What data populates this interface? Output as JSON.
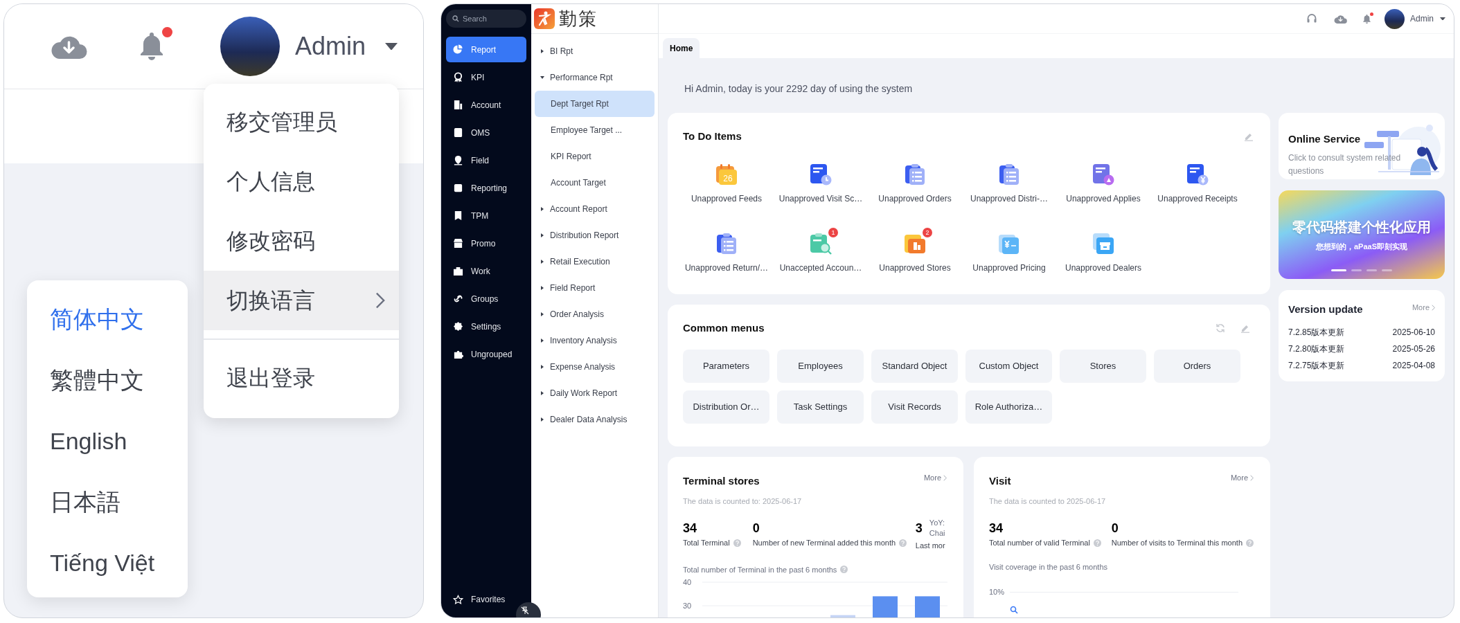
{
  "profile_preview": {
    "user_name": "Admin",
    "notification_dot": true,
    "user_menu": [
      {
        "label": "移交管理员",
        "highlighted": false,
        "has_submenu": false,
        "divider_before": false
      },
      {
        "label": "个人信息",
        "highlighted": false,
        "has_submenu": false,
        "divider_before": false
      },
      {
        "label": "修改密码",
        "highlighted": false,
        "has_submenu": false,
        "divider_before": false
      },
      {
        "label": "切换语言",
        "highlighted": true,
        "has_submenu": true,
        "divider_before": false
      },
      {
        "label": "退出登录",
        "highlighted": false,
        "has_submenu": false,
        "divider_before": true
      }
    ],
    "language_menu": [
      {
        "label": "简体中文",
        "selected": true
      },
      {
        "label": "繁體中文",
        "selected": false
      },
      {
        "label": "English",
        "selected": false
      },
      {
        "label": "日本語",
        "selected": false
      },
      {
        "label": "Tiếng Việt",
        "selected": false
      }
    ]
  },
  "app": {
    "search": {
      "placeholder": "Search"
    },
    "nav": [
      {
        "label": "Report",
        "selected": true
      },
      {
        "label": "KPI",
        "selected": false
      },
      {
        "label": "Account",
        "selected": false
      },
      {
        "label": "OMS",
        "selected": false
      },
      {
        "label": "Field",
        "selected": false
      },
      {
        "label": "Reporting",
        "selected": false
      },
      {
        "label": "TPM",
        "selected": false
      },
      {
        "label": "Promo",
        "selected": false
      },
      {
        "label": "Work",
        "selected": false
      },
      {
        "label": "Groups",
        "selected": false
      },
      {
        "label": "Settings",
        "selected": false
      },
      {
        "label": "Ungrouped",
        "selected": false
      }
    ],
    "favorites": "Favorites",
    "logo_text": "勤策",
    "submenu": [
      {
        "label": "BI Rpt",
        "expanded": false,
        "selected": false
      },
      {
        "label": "Performance Rpt",
        "expanded": true,
        "selected": false,
        "children": [
          {
            "label": "Dept Target Rpt",
            "selected": true
          },
          {
            "label": "Employee Target ...",
            "selected": false
          },
          {
            "label": "KPI Report",
            "selected": false
          },
          {
            "label": "Account Target",
            "selected": false
          }
        ]
      },
      {
        "label": "Account Report",
        "expanded": false,
        "selected": false
      },
      {
        "label": "Distribution Report",
        "expanded": false,
        "selected": false
      },
      {
        "label": "Retail Execution",
        "expanded": false,
        "selected": false
      },
      {
        "label": "Field Report",
        "expanded": false,
        "selected": false
      },
      {
        "label": "Order Analysis",
        "expanded": false,
        "selected": false
      },
      {
        "label": "Inventory Analysis",
        "expanded": false,
        "selected": false
      },
      {
        "label": "Expense Analysis",
        "expanded": false,
        "selected": false
      },
      {
        "label": "Daily Work Report",
        "expanded": false,
        "selected": false
      },
      {
        "label": "Dealer Data Analysis",
        "expanded": false,
        "selected": false
      }
    ],
    "header": {
      "user_name": "Admin",
      "notification_dot": true
    },
    "tabs": [
      {
        "label": "Home",
        "selected": true
      }
    ],
    "greeting": "Hi Admin, today is your 2292 day of using the system",
    "todo": {
      "title": "To Do Items",
      "items": [
        {
          "label": "Unapproved Feeds",
          "icon_text": "26"
        },
        {
          "label": "Unapproved Visit Sc…"
        },
        {
          "label": "Unapproved Orders"
        },
        {
          "label": "Unapproved Distri-…"
        },
        {
          "label": "Unapproved Applies"
        },
        {
          "label": "Unapproved Receipts"
        },
        {
          "label": "Unapproved Return/…"
        },
        {
          "label": "Unaccepted Accoun…",
          "badge": "1"
        },
        {
          "label": "Unapproved Stores",
          "badge": "2"
        },
        {
          "label": "Unapproved Pricing"
        },
        {
          "label": "Unapproved Dealers"
        }
      ]
    },
    "common_menus": {
      "title": "Common menus",
      "items": [
        "Parameters",
        "Employees",
        "Standard Object",
        "Custom Object",
        "Stores",
        "Orders",
        "Distribution Or…",
        "Task Settings",
        "Visit Records",
        "Role Authoriza…"
      ]
    },
    "terminal_stores": {
      "title": "Terminal stores",
      "more": "More",
      "date": "The data is counted to: 2025-06-17",
      "stats": [
        {
          "value": "34",
          "label": "Total Terminal",
          "help": true
        },
        {
          "value": "0",
          "label": "Number of new Terminal added this month",
          "help": true
        },
        {
          "value": "3",
          "label": "Last mor",
          "help": false,
          "notes": [
            "YoY:",
            "Chai"
          ]
        }
      ],
      "chart_help": true,
      "chart_data": {
        "type": "bar",
        "title": "Total number of Terminal in the past 6 months",
        "ylim": [
          25,
          40
        ],
        "yticks": [
          30,
          40
        ],
        "values": [
          null,
          null,
          null,
          26,
          34,
          34
        ]
      }
    },
    "visit": {
      "title": "Visit",
      "more": "More",
      "date": "The data is counted to 2025-06-17",
      "stats": [
        {
          "value": "34",
          "label": "Total number of valid Terminal",
          "help": true
        },
        {
          "value": "0",
          "label": "Number of visits to Terminal this month",
          "help": true
        }
      ],
      "chart_title": "Visit coverage in the past 6 months",
      "chart_tick": "10%"
    },
    "online_service": {
      "title": "Online Service",
      "text": "Click to consult system related questions"
    },
    "banner": {
      "title": "零代码搭建个性化应用",
      "subtitle": "您想到的，aPaaS即刻实现",
      "slides": [
        {
          "selected": true
        },
        {
          "selected": false
        },
        {
          "selected": false
        },
        {
          "selected": false
        }
      ]
    },
    "version_update": {
      "title": "Version update",
      "more": "More",
      "items": [
        {
          "label": "7.2.85版本更新",
          "date": "2025-06-10"
        },
        {
          "label": "7.2.80版本更新",
          "date": "2025-05-26"
        },
        {
          "label": "7.2.75版本更新",
          "date": "2025-04-08"
        }
      ]
    }
  }
}
